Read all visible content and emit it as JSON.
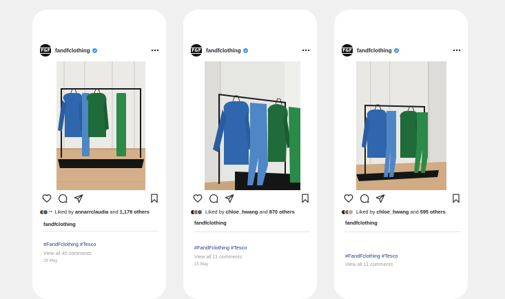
{
  "posts": [
    {
      "username": "fandfclothing",
      "avatar_text": "F&F",
      "liked_prefix": "Liked by",
      "liked_user": "annarrclaudia",
      "liked_and": "and",
      "liked_count": "1,178 others",
      "caption_user": "fandfclothing",
      "hashtags": "#FandFclothing #Tesco",
      "comments_link": "View all 40 comments",
      "date": "28 May"
    },
    {
      "username": "fandfclothing",
      "avatar_text": "F&F",
      "liked_prefix": "Liked by",
      "liked_user": "chloe_hwang",
      "liked_and": "and",
      "liked_count": "870 others",
      "caption_user": "fandfclothing",
      "hashtags": "#FandFclothing #Tesco",
      "comments_link": "View all 11 comments",
      "date": "15 May"
    },
    {
      "username": "fandfclothing",
      "avatar_text": "F&F",
      "liked_prefix": "Liked by",
      "liked_user": "chloe_hwang",
      "liked_and": "and",
      "liked_count": "595 others",
      "caption_user": "fandfclothing",
      "hashtags": "#FandFclothing #Tesco",
      "comments_link": "View all 11 comments",
      "date": ""
    }
  ],
  "icons": [
    "verified-badge-icon",
    "more-options-icon",
    "like-heart-icon",
    "comment-icon",
    "share-icon",
    "save-bookmark-icon"
  ],
  "colors": {
    "background": "#f0f0f1",
    "card": "#ffffff",
    "verified": "#3897f0",
    "hashtag": "#1e3a8a",
    "muted": "#9a9a9a",
    "hoodie_blue": "#2f66ad",
    "jogger_blue": "#4f86c6",
    "hoodie_green": "#1f6b3a",
    "jogger_green": "#2a8a47"
  }
}
